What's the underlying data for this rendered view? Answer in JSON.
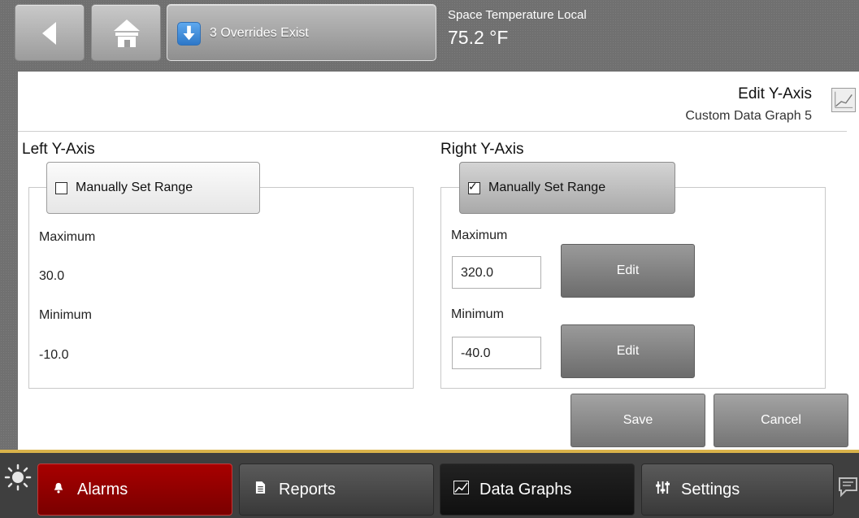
{
  "topbar": {
    "back_icon": "back-arrow-icon",
    "home_icon": "home-icon",
    "override_icon": "download-arrow-icon",
    "override_label": "3 Overrides Exist",
    "temp_title": "Space Temperature Local",
    "temp_value": "75.2 °F"
  },
  "page": {
    "title": "Edit Y-Axis",
    "subtitle": "Custom Data Graph 5",
    "graph_icon": "line-graph-icon"
  },
  "left_axis": {
    "heading": "Left Y-Axis",
    "manual_label": "Manually Set Range",
    "manual_checked": false,
    "max_label": "Maximum",
    "max_value": "30.0",
    "min_label": "Minimum",
    "min_value": "-10.0"
  },
  "right_axis": {
    "heading": "Right Y-Axis",
    "manual_label": "Manually Set Range",
    "manual_checked": true,
    "max_label": "Maximum",
    "max_value": "320.0",
    "max_edit_label": "Edit",
    "min_label": "Minimum",
    "min_value": "-40.0",
    "min_edit_label": "Edit"
  },
  "actions": {
    "save_label": "Save",
    "cancel_label": "Cancel"
  },
  "bottom_nav": {
    "status_icon": "sun-icon",
    "alarms_label": "Alarms",
    "alarms_icon": "bell-icon",
    "reports_label": "Reports",
    "reports_icon": "document-icon",
    "graphs_label": "Data Graphs",
    "graphs_icon": "chart-icon",
    "settings_label": "Settings",
    "settings_icon": "sliders-icon",
    "chat_icon": "chat-icon",
    "colors": {
      "alarms_bg": "#a80000",
      "accent_line": "#d9b24a"
    }
  }
}
